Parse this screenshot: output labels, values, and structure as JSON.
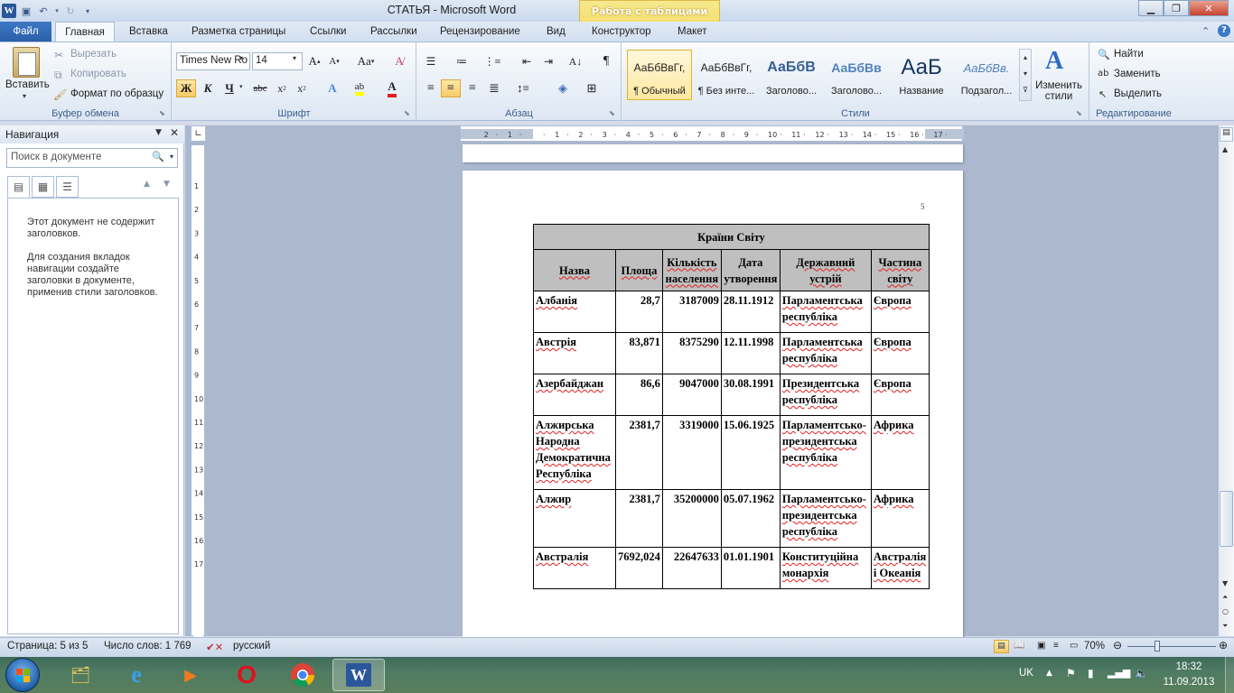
{
  "titlebar": {
    "title": "СТАТЬЯ  -  Microsoft Word",
    "context_group": "Работа с таблицами",
    "word_logo": "W"
  },
  "tabs": [
    {
      "label": "Файл"
    },
    {
      "label": "Главная"
    },
    {
      "label": "Вставка"
    },
    {
      "label": "Разметка страницы"
    },
    {
      "label": "Ссылки"
    },
    {
      "label": "Рассылки"
    },
    {
      "label": "Рецензирование"
    },
    {
      "label": "Вид"
    },
    {
      "label": "Конструктор"
    },
    {
      "label": "Макет"
    }
  ],
  "ribbon": {
    "clipboard": {
      "paste": "Вставить",
      "cut": "Вырезать",
      "copy": "Копировать",
      "format_painter": "Формат по образцу",
      "label": "Буфер обмена"
    },
    "font": {
      "name": "Times New Ro",
      "size": "14",
      "label": "Шрифт"
    },
    "paragraph": {
      "label": "Абзац"
    },
    "styles": {
      "label": "Стили",
      "items": [
        {
          "sample": "АаБбВвГг,",
          "name": "¶ Обычный"
        },
        {
          "sample": "АаБбВвГг,",
          "name": "¶ Без инте..."
        },
        {
          "sample": "АаБбВ",
          "name": "Заголово..."
        },
        {
          "sample": "АаБбВв",
          "name": "Заголово..."
        },
        {
          "sample": "АаБ",
          "name": "Название"
        },
        {
          "sample": "АаБбВв.",
          "name": "Подзагол..."
        }
      ],
      "change_styles": "Изменить стили"
    },
    "editing": {
      "label": "Редактирование",
      "find": "Найти",
      "replace": "Заменить",
      "select": "Выделить"
    }
  },
  "navigation": {
    "title": "Навигация",
    "search_placeholder": "Поиск в документе",
    "message1": "Этот документ не содержит заголовков.",
    "message2": "Для создания вкладок навигации создайте заголовки в документе, применив стили заголовков."
  },
  "document": {
    "page_number": "5",
    "table": {
      "title": "Країни Світу",
      "headers": [
        "Назва",
        "Площа",
        "Кількість населення",
        "Дата утворення",
        "Державний устрій",
        "Частина світу"
      ],
      "rows": [
        [
          "Албанія",
          "28,7",
          "3187009",
          "28.11.1912",
          "Парламентська республіка",
          "Європа"
        ],
        [
          "Австрія",
          "83,871",
          "8375290",
          "12.11.1998",
          "Парламентська республіка",
          "Європа"
        ],
        [
          "Азербайджан",
          "86,6",
          "9047000",
          "30.08.1991",
          "Президентська республіка",
          "Європа"
        ],
        [
          "Алжирська Народна Демократична Республіка",
          "2381,7",
          "3319000",
          "15.06.1925",
          "Парламентсько-президентська республіка",
          "Африка"
        ],
        [
          "Алжир",
          "2381,7",
          "35200000",
          "05.07.1962",
          "Парламентсько-президентська республіка",
          "Африка"
        ],
        [
          "Австралія",
          "7692,024",
          "22647633",
          "01.01.1901",
          "Конституційна монархія",
          "Австралія і Океанія"
        ]
      ]
    }
  },
  "statusbar": {
    "page": "Страница: 5 из 5",
    "words": "Число слов: 1 769",
    "language": "русский",
    "zoom": "70%",
    "zoom_value": 0.7
  },
  "taskbar": {
    "lang": "UK",
    "time": "18:32",
    "date": "11.09.2013"
  }
}
